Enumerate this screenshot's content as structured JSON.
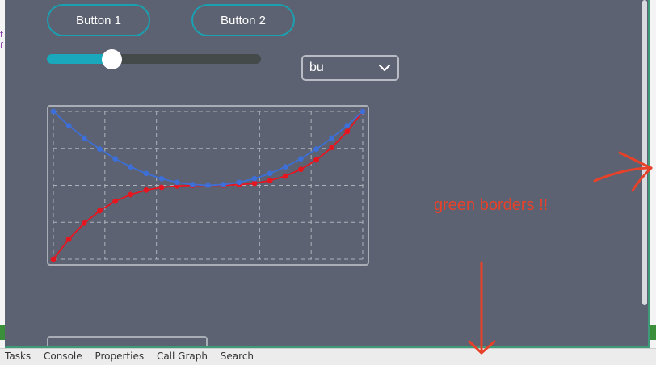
{
  "background_ide": {
    "tabs": [
      "Tasks",
      "Console",
      "Properties",
      "Call Graph",
      "Search"
    ],
    "left_text": [
      "f",
      "f"
    ]
  },
  "buttons": {
    "button1_label": "Button 1",
    "button2_label": "Button 2"
  },
  "slider": {
    "value_fraction": 0.3
  },
  "dropdown": {
    "selected": "bu",
    "icon": "chevron-down-icon"
  },
  "annotation": {
    "text": "green borders !!",
    "color": "#e8412a"
  },
  "colors": {
    "panel_bg": "#5c6272",
    "accent": "#1aa0b0",
    "series_red": "#e8141e",
    "series_blue": "#3d6fd6"
  },
  "chart_data": {
    "type": "line",
    "grid": true,
    "xlim": [
      -1,
      1
    ],
    "ylim": [
      -1,
      1
    ],
    "x": [
      -1.0,
      -0.9,
      -0.8,
      -0.7,
      -0.6,
      -0.5,
      -0.4,
      -0.3,
      -0.2,
      -0.1,
      0.0,
      0.1,
      0.2,
      0.3,
      0.4,
      0.5,
      0.6,
      0.7,
      0.8,
      0.9,
      1.0
    ],
    "series": [
      {
        "color": "#e8141e",
        "values": [
          -1.0,
          -0.729,
          -0.512,
          -0.343,
          -0.216,
          -0.125,
          -0.064,
          -0.027,
          -0.008,
          -0.001,
          0.0,
          0.001,
          0.008,
          0.027,
          0.064,
          0.125,
          0.216,
          0.343,
          0.512,
          0.729,
          1.0
        ]
      },
      {
        "color": "#3d6fd6",
        "values": [
          1.0,
          0.81,
          0.64,
          0.49,
          0.36,
          0.25,
          0.16,
          0.09,
          0.04,
          0.01,
          0.0,
          0.01,
          0.04,
          0.09,
          0.16,
          0.25,
          0.36,
          0.49,
          0.64,
          0.81,
          1.0
        ]
      }
    ]
  }
}
